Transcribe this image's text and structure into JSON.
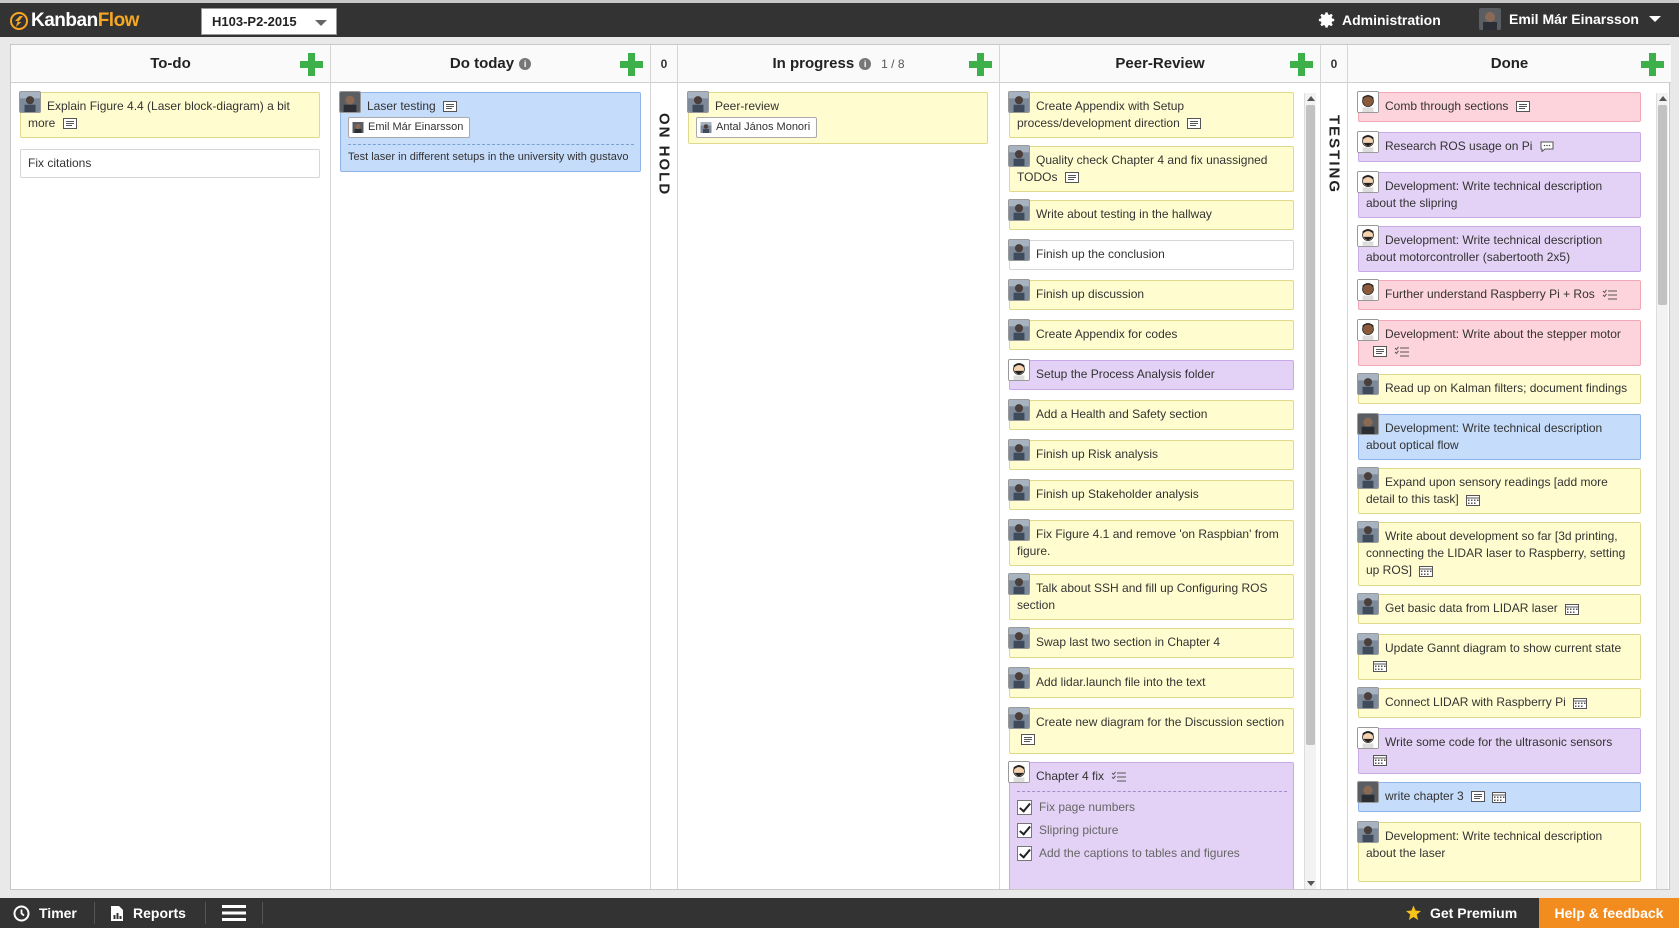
{
  "app": {
    "logo_part1": "Kanban",
    "logo_part2": "Flow"
  },
  "topbar": {
    "board_name": "H103-P2-2015",
    "administration": "Administration",
    "user_name": "Emil Már Einarsson"
  },
  "columns": {
    "todo": {
      "title": "To-do"
    },
    "today": {
      "title": "Do today",
      "info": "i"
    },
    "onhold": {
      "title": "ON HOLD",
      "count": "0"
    },
    "inprogress": {
      "title": "In progress",
      "info": "i",
      "wip": "1 / 8"
    },
    "peer": {
      "title": "Peer-Review"
    },
    "testing": {
      "title": "TESTING",
      "count": "0"
    },
    "done": {
      "title": "Done"
    }
  },
  "todo_cards": [
    {
      "text": "Explain Figure 4.4 (Laser block-diagram) a bit more"
    },
    {
      "text": "Fix citations"
    }
  ],
  "today_card": {
    "text": "Laser testing",
    "assignee": "Emil Már Einarsson",
    "description": "Test laser in different setups in the university with gustavo"
  },
  "progress_card": {
    "text": "Peer-review",
    "assignee": "Antal János Monori"
  },
  "peer_cards": [
    {
      "text": "Create Appendix with Setup process/development direction"
    },
    {
      "text": "Quality check Chapter 4 and fix unassigned TODOs"
    },
    {
      "text": "Write about testing in the hallway"
    },
    {
      "text": "Finish up the conclusion"
    },
    {
      "text": "Finish up discussion"
    },
    {
      "text": "Create Appendix for codes"
    },
    {
      "text": "Setup the Process Analysis folder"
    },
    {
      "text": "Add a Health and Safety section"
    },
    {
      "text": "Finish up Risk analysis"
    },
    {
      "text": "Finish up Stakeholder analysis"
    },
    {
      "text": "Fix Figure 4.1 and remove 'on Raspbian' from figure."
    },
    {
      "text": "Talk about SSH and fill up Configuring ROS section"
    },
    {
      "text": "Swap last two section in Chapter 4"
    },
    {
      "text": "Add lidar.launch file into the text"
    },
    {
      "text": "Create new diagram for the Discussion section"
    },
    {
      "text": "Chapter 4 fix",
      "subtasks": [
        "Fix page numbers",
        "Slipring picture",
        "Add the captions to tables and figures"
      ]
    }
  ],
  "done_cards": [
    {
      "text": "Comb through sections"
    },
    {
      "text": "Research ROS usage on Pi"
    },
    {
      "text": "Development: Write technical description about the slipring"
    },
    {
      "text": "Development: Write technical description about motorcontroller (sabertooth 2x5)"
    },
    {
      "text": "Further understand Raspberry Pi + Ros"
    },
    {
      "text": "Development: Write about the stepper motor"
    },
    {
      "text": "Read up on Kalman filters; document findings"
    },
    {
      "text": "Development: Write technical description about optical flow"
    },
    {
      "text": "Expand upon sensory readings [add more detail to this task]"
    },
    {
      "text": "Write about development so far [3d printing, connecting the LIDAR laser to Raspberry, setting up ROS]"
    },
    {
      "text": "Get basic data from LIDAR laser"
    },
    {
      "text": "Update Gannt diagram to show current state"
    },
    {
      "text": "Connect LIDAR with Raspberry Pi"
    },
    {
      "text": "Write some code for the ultrasonic sensors"
    },
    {
      "text": "write chapter 3"
    },
    {
      "text": "Development: Write technical description about the laser"
    }
  ],
  "bottombar": {
    "timer": "Timer",
    "reports": "Reports",
    "premium": "Get Premium",
    "help": "Help & feedback"
  },
  "colors": {
    "yellow": "#fffdcf",
    "purple": "#e3d2f5",
    "blue": "#c5dcfb",
    "pink": "#fdd3dc",
    "add": "#3eb049",
    "help": "#f28c1e"
  }
}
